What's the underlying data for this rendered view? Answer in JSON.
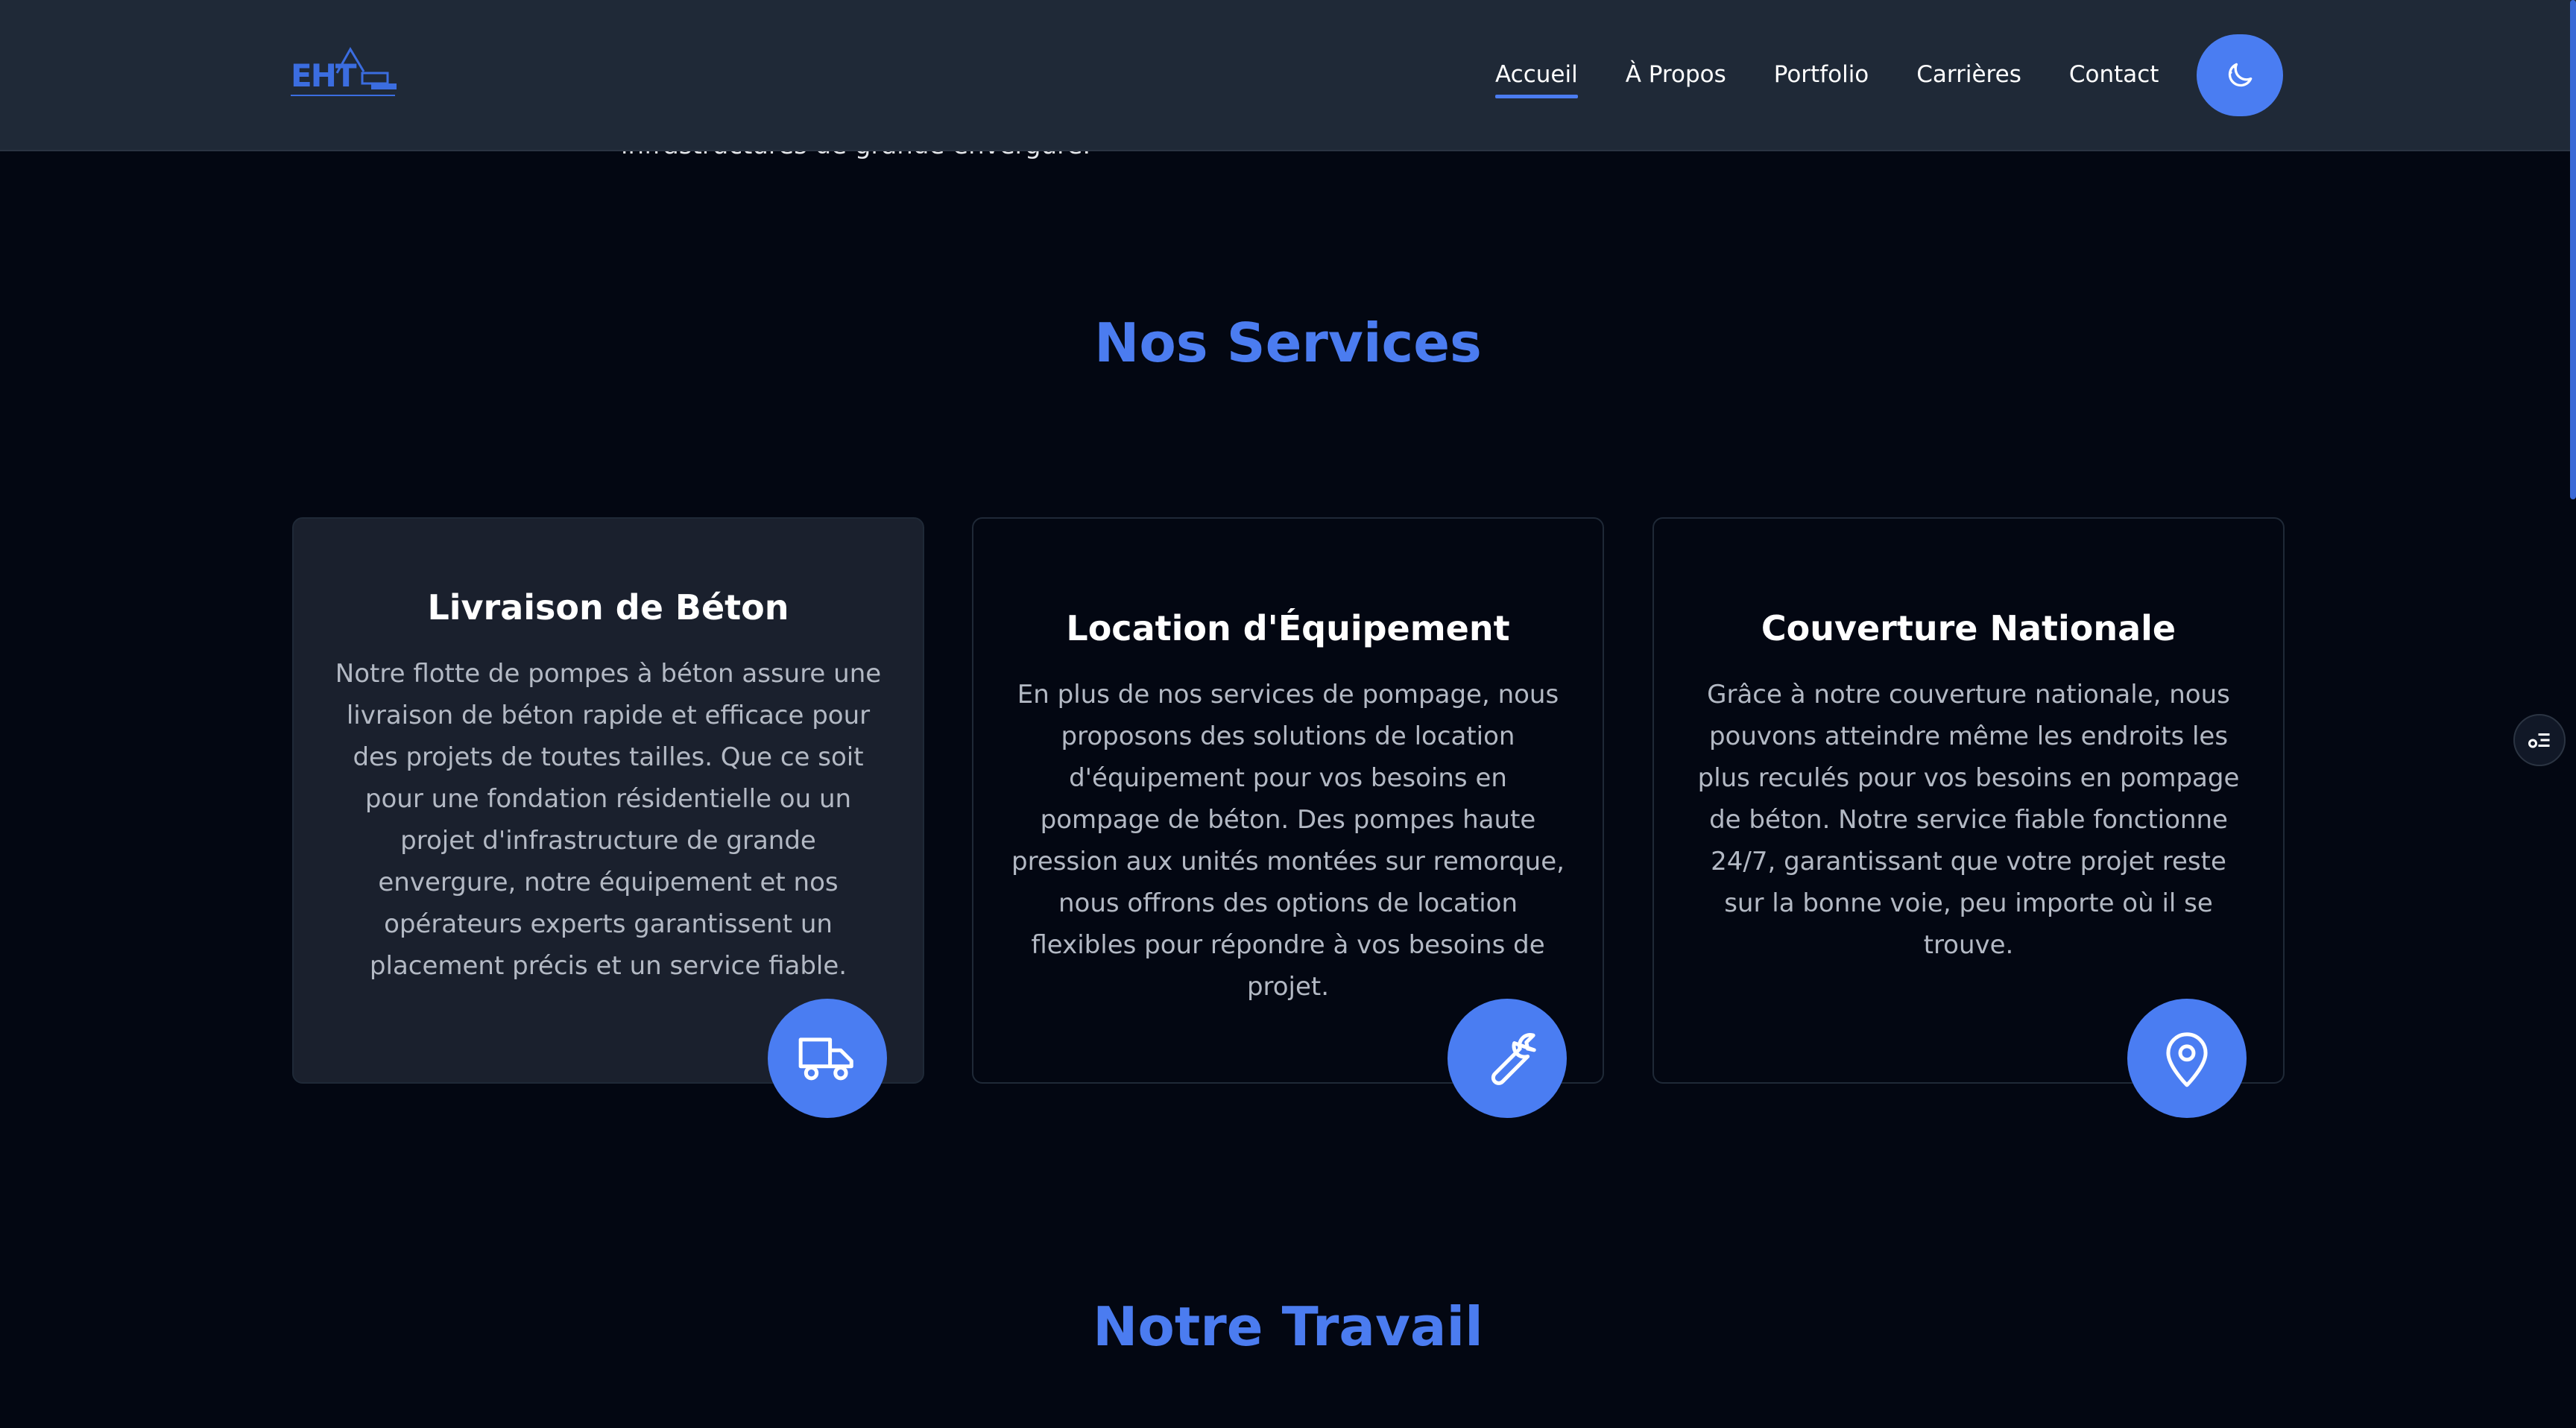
{
  "hero": {
    "tail_text": "infrastructures de grande envergure."
  },
  "header": {
    "logo_text": "EHT",
    "nav": [
      {
        "label": "Accueil",
        "active": true
      },
      {
        "label": "À Propos",
        "active": false
      },
      {
        "label": "Portfolio",
        "active": false
      },
      {
        "label": "Carrières",
        "active": false
      },
      {
        "label": "Contact",
        "active": false
      }
    ],
    "theme_toggle_icon": "moon-icon"
  },
  "services": {
    "title": "Nos Services",
    "cards": [
      {
        "title": "Livraison de Béton",
        "description": "Notre flotte de pompes à béton assure une livraison de béton rapide et efficace pour des projets de toutes tailles. Que ce soit pour une fondation résidentielle ou un projet d'infrastructure de grande envergure, notre équipement et nos opérateurs experts garantissent un placement précis et un service fiable.",
        "icon": "truck-icon"
      },
      {
        "title": "Location d'Équipement",
        "description": "En plus de nos services de pompage, nous proposons des solutions de location d'équipement pour vos besoins en pompage de béton. Des pompes haute pression aux unités montées sur remorque, nous offrons des options de location flexibles pour répondre à vos besoins de projet.",
        "icon": "wrench-icon"
      },
      {
        "title": "Couverture Nationale",
        "description": "Grâce à notre couverture nationale, nous pouvons atteindre même les endroits les plus reculés pour vos besoins en pompage de béton. Notre service fiable fonctionne 24/7, garantissant que votre projet reste sur la bonne voie, peu importe où il se trouve.",
        "icon": "map-pin-icon"
      }
    ]
  },
  "work": {
    "title": "Notre Travail"
  },
  "colors": {
    "accent": "#4a7df2",
    "background": "#030712",
    "header": "#1f2937"
  }
}
